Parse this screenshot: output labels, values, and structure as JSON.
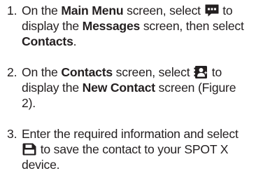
{
  "steps": [
    {
      "number": "1.",
      "parts": {
        "t1": "On the ",
        "b1": "Main Menu",
        "t2": " screen, select ",
        "icon": "messages-icon",
        "t3": " to display the ",
        "b2": "Messages",
        "t4": " screen, then select ",
        "b3": "Contacts",
        "t5": "."
      }
    },
    {
      "number": "2.",
      "parts": {
        "t1": "On the ",
        "b1": "Contacts",
        "t2": " screen, select ",
        "icon": "new-contact-icon",
        "t3": " to display the ",
        "b2": "New Contact",
        "t4": " screen (Figure 2)."
      }
    },
    {
      "number": "3.",
      "parts": {
        "t1": "Enter the required information and select ",
        "icon": "save-icon",
        "t2": " to save the contact to your SPOT X device."
      }
    }
  ],
  "colors": {
    "text": "#231f20",
    "icon": "#231f20"
  }
}
